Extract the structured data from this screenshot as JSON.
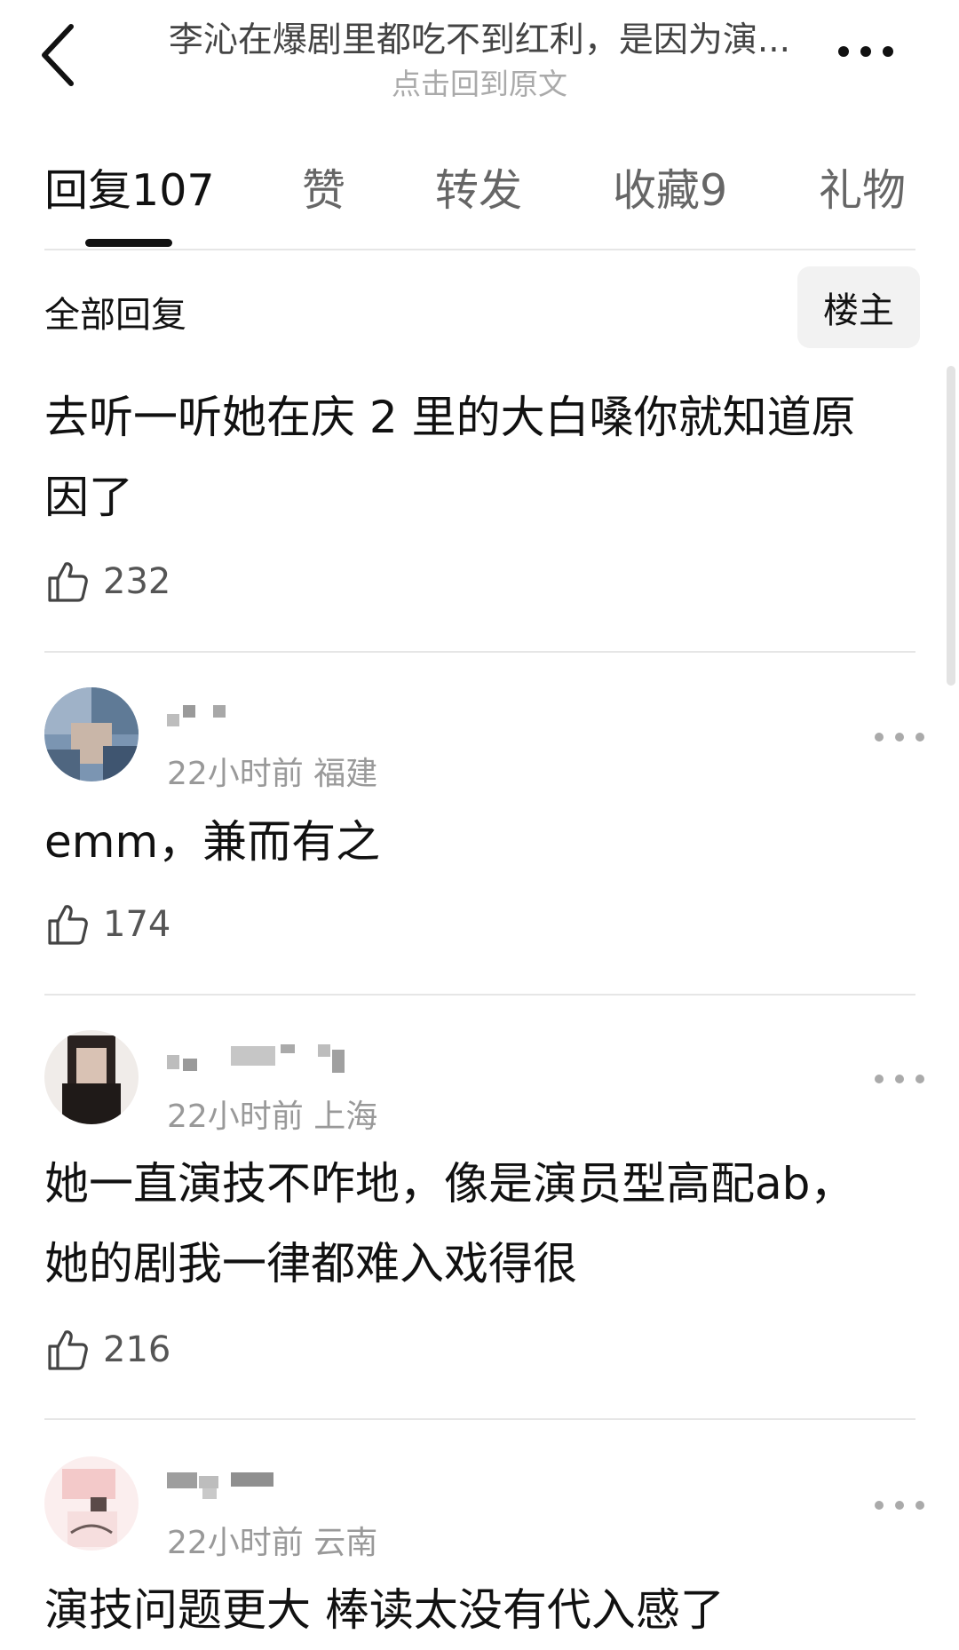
{
  "header": {
    "title": "李沁在爆剧里都吃不到红利，是因为演...",
    "subtitle": "点击回到原文"
  },
  "tabs": [
    {
      "label": "回复",
      "count": "107"
    },
    {
      "label": "赞",
      "count": ""
    },
    {
      "label": "转发",
      "count": ""
    },
    {
      "label": "收藏",
      "count": "9"
    },
    {
      "label": "礼物",
      "count": ""
    }
  ],
  "filter": {
    "label": "全部回复",
    "owner_button": "楼主"
  },
  "main_reply": {
    "text_line1": "去听一听她在庆 2 里的大白嗓你就知道原",
    "text_line2": "因了",
    "likes": "232"
  },
  "comments": [
    {
      "time": "22小时前",
      "location": "福建",
      "text_line1": "emm，兼而有之",
      "text_line2": "",
      "likes": "174"
    },
    {
      "time": "22小时前",
      "location": "上海",
      "text_line1": "她一直演技不咋地，像是演员型高配ab，",
      "text_line2": "她的剧我一律都难入戏得很",
      "likes": "216"
    },
    {
      "time": "22小时前",
      "location": "云南",
      "text_line1": "演技问题更大 棒读太没有代入感了",
      "text_line2": "",
      "likes": ""
    }
  ],
  "colors": {
    "text": "#111111",
    "muted": "#999999",
    "divider": "#e6e6e6",
    "accent": "#111111"
  },
  "icons": [
    "back-arrow-icon",
    "more-dots-icon",
    "thumbs-up-icon"
  ]
}
